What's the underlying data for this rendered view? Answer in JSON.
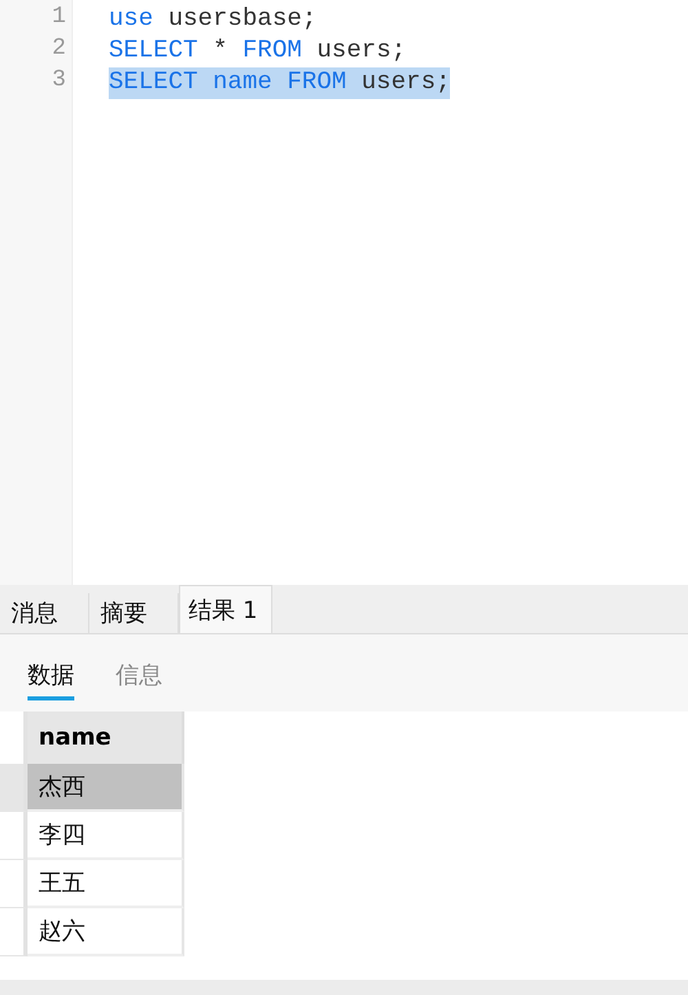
{
  "editor": {
    "lines": [
      {
        "number": "1",
        "selected": false,
        "tokens": [
          {
            "kind": "keyword",
            "text": "use"
          },
          {
            "kind": "plain",
            "text": " usersbase;"
          }
        ]
      },
      {
        "number": "2",
        "selected": false,
        "tokens": [
          {
            "kind": "keyword",
            "text": "SELECT"
          },
          {
            "kind": "plain",
            "text": " * "
          },
          {
            "kind": "keyword",
            "text": "FROM"
          },
          {
            "kind": "plain",
            "text": " users;"
          }
        ]
      },
      {
        "number": "3",
        "selected": true,
        "tokens": [
          {
            "kind": "keyword",
            "text": "SELECT name FROM"
          },
          {
            "kind": "plain",
            "text": " users;"
          }
        ]
      }
    ]
  },
  "result_tabs": [
    {
      "label": "消息",
      "selected": false
    },
    {
      "label": "摘要",
      "selected": false
    },
    {
      "label": "结果 1",
      "selected": true
    }
  ],
  "view_tabs": [
    {
      "label": "数据",
      "selected": true
    },
    {
      "label": "信息",
      "selected": false
    }
  ],
  "table": {
    "columns": [
      "name"
    ],
    "rows": [
      {
        "cells": [
          "杰西"
        ],
        "selected": true
      },
      {
        "cells": [
          "李四"
        ],
        "selected": false
      },
      {
        "cells": [
          "王五"
        ],
        "selected": false
      },
      {
        "cells": [
          "赵六"
        ],
        "selected": false
      }
    ]
  }
}
